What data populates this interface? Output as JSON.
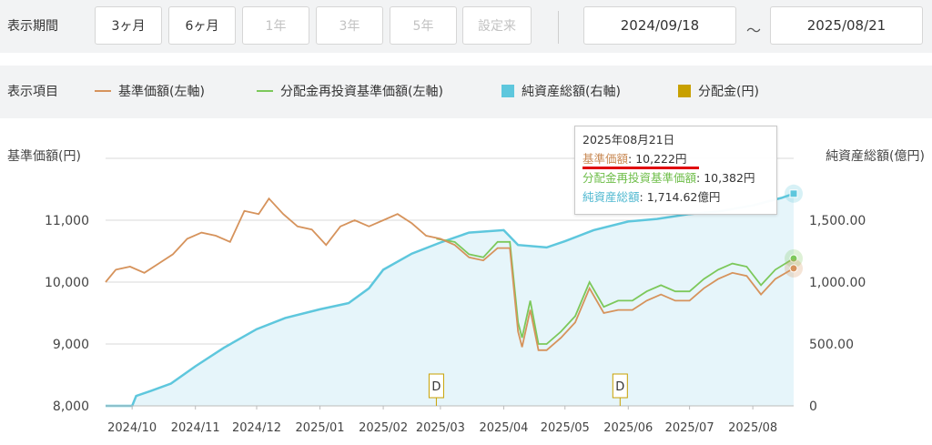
{
  "period": {
    "label": "表示期間",
    "buttons": [
      {
        "label": "3ヶ月",
        "enabled": true
      },
      {
        "label": "6ヶ月",
        "enabled": true
      },
      {
        "label": "1年",
        "enabled": false
      },
      {
        "label": "3年",
        "enabled": false
      },
      {
        "label": "5年",
        "enabled": false
      },
      {
        "label": "設定来",
        "enabled": false
      }
    ],
    "from": "2024/09/18",
    "tilde": "～",
    "to": "2025/08/21"
  },
  "items": {
    "label": "表示項目",
    "legend": [
      {
        "label": "基準価額(左軸)",
        "color": "#d6935c",
        "shape": "line"
      },
      {
        "label": "分配金再投資基準価額(左軸)",
        "color": "#7cc85a",
        "shape": "line"
      },
      {
        "label": "純資産総額(右軸)",
        "color": "#5ec7dd",
        "shape": "square"
      },
      {
        "label": "分配金(円)",
        "color": "#c8a000",
        "shape": "square"
      }
    ]
  },
  "chart_data": {
    "type": "line",
    "left_axis_title": "基準価額(円)",
    "right_axis_title": "純資産総額(億円)",
    "left_ylim": [
      8000,
      12000
    ],
    "right_ylim": [
      0,
      2000
    ],
    "left_ticks": [
      "8,000",
      "9,000",
      "10,000",
      "11,000"
    ],
    "right_ticks": [
      "0",
      "500.00",
      "1,000.00",
      "1,500.00"
    ],
    "x_ticks": [
      "2024/10",
      "2024/11",
      "2024/12",
      "2025/01",
      "2025/02",
      "2025/03",
      "2025/04",
      "2025/05",
      "2025/06",
      "2025/07",
      "2025/08"
    ],
    "x_tick_dates": [
      "2024-10-01",
      "2024-11-01",
      "2024-12-01",
      "2025-01-01",
      "2025-02-01",
      "2025-03-01",
      "2025-04-01",
      "2025-05-01",
      "2025-06-01",
      "2025-07-01",
      "2025-08-01"
    ],
    "start": "2024-09-18",
    "end": "2025-08-21",
    "series": [
      {
        "name": "基準価額(左軸)",
        "color": "#d6935c",
        "points": [
          [
            "2024-09-18",
            10000
          ],
          [
            "2024-09-23",
            10200
          ],
          [
            "2024-09-30",
            10250
          ],
          [
            "2024-10-07",
            10150
          ],
          [
            "2024-10-14",
            10300
          ],
          [
            "2024-10-21",
            10450
          ],
          [
            "2024-10-28",
            10700
          ],
          [
            "2024-11-04",
            10800
          ],
          [
            "2024-11-11",
            10750
          ],
          [
            "2024-11-18",
            10650
          ],
          [
            "2024-11-25",
            11150
          ],
          [
            "2024-12-02",
            11100
          ],
          [
            "2024-12-07",
            11350
          ],
          [
            "2024-12-14",
            11100
          ],
          [
            "2024-12-21",
            10900
          ],
          [
            "2024-12-28",
            10850
          ],
          [
            "2025-01-04",
            10600
          ],
          [
            "2025-01-11",
            10900
          ],
          [
            "2025-01-18",
            11000
          ],
          [
            "2025-01-25",
            10900
          ],
          [
            "2025-02-01",
            11000
          ],
          [
            "2025-02-08",
            11100
          ],
          [
            "2025-02-15",
            10950
          ],
          [
            "2025-02-22",
            10750
          ],
          [
            "2025-03-01",
            10700
          ],
          [
            "2025-03-08",
            10600
          ],
          [
            "2025-03-15",
            10400
          ],
          [
            "2025-03-22",
            10350
          ],
          [
            "2025-03-29",
            10550
          ],
          [
            "2025-04-04",
            10550
          ],
          [
            "2025-04-08",
            9200
          ],
          [
            "2025-04-10",
            8950
          ],
          [
            "2025-04-14",
            9550
          ],
          [
            "2025-04-18",
            8900
          ],
          [
            "2025-04-22",
            8900
          ],
          [
            "2025-04-29",
            9100
          ],
          [
            "2025-05-06",
            9350
          ],
          [
            "2025-05-13",
            9900
          ],
          [
            "2025-05-20",
            9500
          ],
          [
            "2025-05-27",
            9550
          ],
          [
            "2025-06-03",
            9550
          ],
          [
            "2025-06-10",
            9700
          ],
          [
            "2025-06-17",
            9800
          ],
          [
            "2025-06-24",
            9700
          ],
          [
            "2025-07-01",
            9700
          ],
          [
            "2025-07-08",
            9900
          ],
          [
            "2025-07-15",
            10050
          ],
          [
            "2025-07-22",
            10150
          ],
          [
            "2025-07-29",
            10100
          ],
          [
            "2025-08-05",
            9800
          ],
          [
            "2025-08-12",
            10050
          ],
          [
            "2025-08-21",
            10222
          ]
        ]
      },
      {
        "name": "分配金再投資基準価額(左軸)",
        "color": "#7cc85a",
        "points": [
          [
            "2025-02-27",
            10700
          ],
          [
            "2025-03-08",
            10650
          ],
          [
            "2025-03-15",
            10450
          ],
          [
            "2025-03-22",
            10400
          ],
          [
            "2025-03-29",
            10650
          ],
          [
            "2025-04-04",
            10650
          ],
          [
            "2025-04-08",
            9350
          ],
          [
            "2025-04-10",
            9100
          ],
          [
            "2025-04-14",
            9700
          ],
          [
            "2025-04-18",
            9000
          ],
          [
            "2025-04-22",
            9000
          ],
          [
            "2025-04-29",
            9200
          ],
          [
            "2025-05-06",
            9450
          ],
          [
            "2025-05-13",
            10000
          ],
          [
            "2025-05-20",
            9600
          ],
          [
            "2025-05-27",
            9700
          ],
          [
            "2025-06-03",
            9700
          ],
          [
            "2025-06-10",
            9850
          ],
          [
            "2025-06-17",
            9950
          ],
          [
            "2025-06-24",
            9850
          ],
          [
            "2025-07-01",
            9850
          ],
          [
            "2025-07-08",
            10050
          ],
          [
            "2025-07-15",
            10200
          ],
          [
            "2025-07-22",
            10300
          ],
          [
            "2025-07-29",
            10250
          ],
          [
            "2025-08-05",
            9950
          ],
          [
            "2025-08-12",
            10200
          ],
          [
            "2025-08-21",
            10382
          ]
        ]
      },
      {
        "name": "純資産総額(右軸)",
        "color": "#5ec7dd",
        "axis": "right",
        "points": [
          [
            "2024-09-18",
            0
          ],
          [
            "2024-10-01",
            0
          ],
          [
            "2024-10-03",
            80
          ],
          [
            "2024-10-10",
            120
          ],
          [
            "2024-10-20",
            180
          ],
          [
            "2024-11-01",
            320
          ],
          [
            "2024-11-15",
            470
          ],
          [
            "2024-12-01",
            620
          ],
          [
            "2024-12-15",
            710
          ],
          [
            "2025-01-01",
            780
          ],
          [
            "2025-01-15",
            830
          ],
          [
            "2025-01-25",
            950
          ],
          [
            "2025-02-01",
            1100
          ],
          [
            "2025-02-15",
            1230
          ],
          [
            "2025-03-01",
            1320
          ],
          [
            "2025-03-15",
            1400
          ],
          [
            "2025-04-01",
            1420
          ],
          [
            "2025-04-08",
            1300
          ],
          [
            "2025-04-22",
            1280
          ],
          [
            "2025-05-01",
            1330
          ],
          [
            "2025-05-15",
            1420
          ],
          [
            "2025-06-01",
            1490
          ],
          [
            "2025-06-15",
            1510
          ],
          [
            "2025-07-01",
            1550
          ],
          [
            "2025-07-15",
            1570
          ],
          [
            "2025-08-01",
            1620
          ],
          [
            "2025-08-15",
            1680
          ],
          [
            "2025-08-21",
            1714.62
          ]
        ]
      }
    ],
    "distributions": [
      {
        "date": "2025-02-27",
        "label": "D"
      },
      {
        "date": "2025-05-28",
        "label": "D"
      }
    ],
    "tooltip": {
      "date": "2025年08月21日",
      "nav_label": "基準価額",
      "nav_value": "10,222円",
      "reinvest_label": "分配金再投資基準価額",
      "reinvest_value": "10,382円",
      "assets_label": "純資産総額",
      "assets_value": "1,714.62億円"
    }
  }
}
